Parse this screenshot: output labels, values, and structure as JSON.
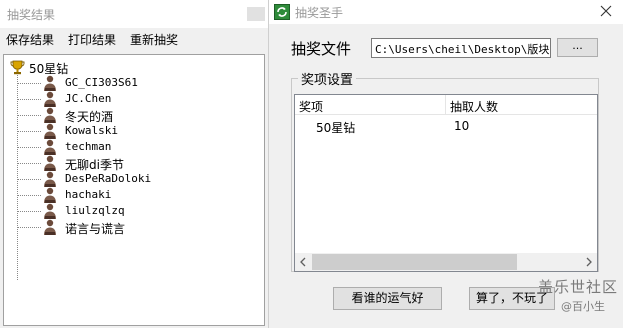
{
  "results_window": {
    "title": "抽奖结果",
    "menu": [
      "保存结果",
      "打印结果",
      "重新抽奖"
    ],
    "tree": {
      "root": "50星钻",
      "winners": [
        "GC_CI303S61",
        "JC.Chen",
        "冬天的酒",
        "Kowalski",
        "techman",
        "无聊di季节",
        "DesPeRaDoloki",
        "hachaki",
        "liulzqlzq",
        "诺言与谎言"
      ]
    }
  },
  "main_window": {
    "title": "抽奖圣手",
    "file_label": "抽奖文件",
    "file_path": "C:\\Users\\cheil\\Desktop\\版块活",
    "browse_label": "...",
    "group_title": "奖项设置",
    "table": {
      "columns": [
        "奖项",
        "抽取人数"
      ],
      "rows": [
        [
          "50星钻",
          "10"
        ]
      ]
    },
    "buttons": {
      "draw": "看谁的运气好",
      "quit": "算了，不玩了"
    }
  },
  "watermark": {
    "main": "盖乐世社区",
    "sub": "@百小生"
  }
}
